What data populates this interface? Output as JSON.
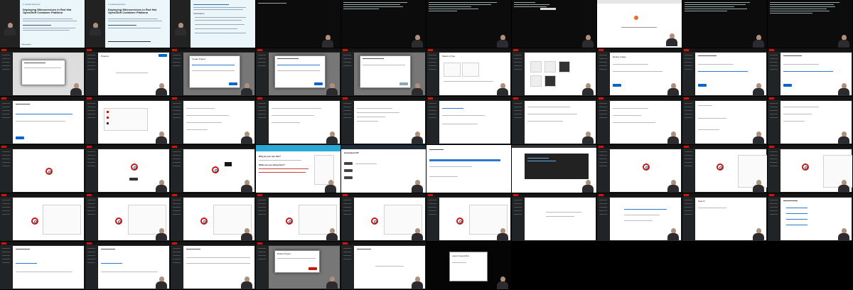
{
  "slides": [
    {
      "label": "1 Guided Exercise",
      "title": "Deploying Microservices in Red Hat OpenShift Container Platform",
      "footer": "Deploying Apps"
    },
    {
      "label": "1 Guided Exercise",
      "title": "Deploying Microservices in Red Hat OpenShift Container Platform"
    }
  ],
  "instructions_heading": "Instructions",
  "project_heading": "Projects",
  "create_project_title": "Create Project",
  "select_heading": "Select a Type",
  "deploy_title": "Deploy Image",
  "app_banner_title": "Generated API",
  "question_why": "Why do you use this?",
  "question_how": "What are you doing here?",
  "search_heading": "Search",
  "delete_title": "Delete Project",
  "confirm_text": "Logout of openshift.io"
}
